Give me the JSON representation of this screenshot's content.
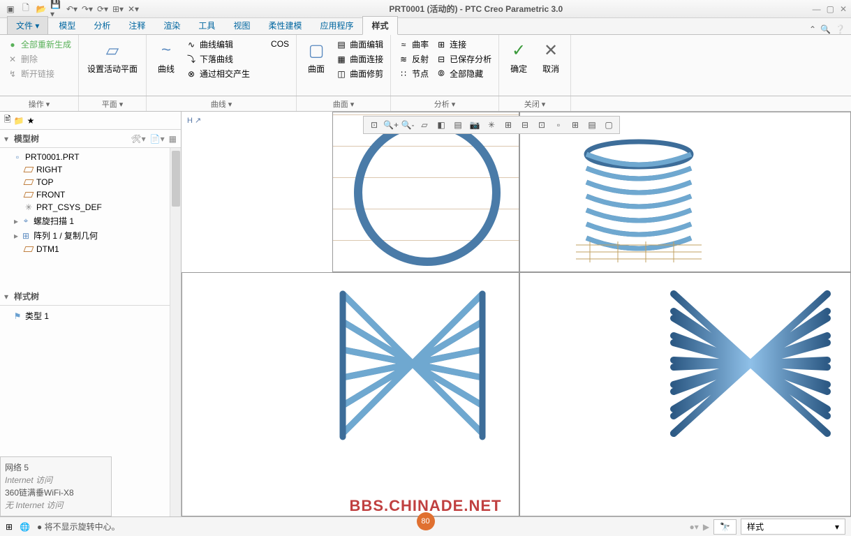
{
  "title": "PRT0001 (活动的) - PTC Creo Parametric 3.0",
  "tabs": [
    "文件 ▾",
    "模型",
    "分析",
    "注释",
    "渲染",
    "工具",
    "视图",
    "柔性建模",
    "应用程序",
    "样式"
  ],
  "active_tab": 9,
  "ribbon": {
    "groups": [
      {
        "label": "操作",
        "items": [
          {
            "t": "small",
            "label": "全部重新生成",
            "ico": "●",
            "cls": "bullet"
          },
          {
            "t": "small",
            "label": "删除",
            "ico": "✕",
            "cls": "dim"
          },
          {
            "t": "small",
            "label": "断开链接",
            "ico": "↯",
            "cls": "dim"
          }
        ]
      },
      {
        "label": "平面",
        "items": [
          {
            "t": "big",
            "label": "设置活动平面",
            "ico": "▱"
          }
        ]
      },
      {
        "label": "曲线",
        "items": [
          {
            "t": "big",
            "label": "曲线",
            "ico": "~"
          },
          {
            "t": "col",
            "sub": [
              {
                "label": "曲线编辑",
                "ico": "∿"
              },
              {
                "label": "下落曲线",
                "ico": "⤵"
              },
              {
                "label": "通过相交产生",
                "ico": "⊗"
              }
            ]
          },
          {
            "t": "small",
            "label": "COS",
            "ico": ""
          }
        ]
      },
      {
        "label": "曲面",
        "items": [
          {
            "t": "big",
            "label": "曲面",
            "ico": "▢"
          },
          {
            "t": "col",
            "sub": [
              {
                "label": "曲面编辑",
                "ico": "▤"
              },
              {
                "label": "曲面连接",
                "ico": "▦"
              },
              {
                "label": "曲面修剪",
                "ico": "◫"
              }
            ]
          }
        ]
      },
      {
        "label": "分析",
        "items": [
          {
            "t": "col",
            "sub": [
              {
                "label": "曲率",
                "ico": "≈"
              },
              {
                "label": "反射",
                "ico": "≋"
              },
              {
                "label": "节点",
                "ico": "∷"
              }
            ]
          },
          {
            "t": "col",
            "sub": [
              {
                "label": "连接",
                "ico": "⊞"
              },
              {
                "label": "已保存分析",
                "ico": "⊟"
              },
              {
                "label": "全部隐藏",
                "ico": "⦾"
              }
            ]
          }
        ]
      },
      {
        "label": "关闭",
        "items": [
          {
            "t": "big",
            "label": "确定",
            "ico": "✓",
            "color": "#3a9a3a"
          },
          {
            "t": "big",
            "label": "取消",
            "ico": "✕",
            "color": "#666"
          }
        ]
      }
    ]
  },
  "model_tree_title": "模型树",
  "model_tree": [
    {
      "label": "PRT0001.PRT",
      "ico": "box",
      "indent": 0
    },
    {
      "label": "RIGHT",
      "ico": "datum",
      "indent": 1
    },
    {
      "label": "TOP",
      "ico": "datum",
      "indent": 1
    },
    {
      "label": "FRONT",
      "ico": "datum",
      "indent": 1
    },
    {
      "label": "PRT_CSYS_DEF",
      "ico": "csys",
      "indent": 1
    },
    {
      "label": "螺旋扫描 1",
      "ico": "helix",
      "indent": 1,
      "exp": true
    },
    {
      "label": "阵列 1 / 复制几何",
      "ico": "pattern",
      "indent": 1,
      "exp": true
    },
    {
      "label": "DTM1",
      "ico": "datum",
      "indent": 1
    }
  ],
  "style_tree_title": "样式树",
  "style_tree": [
    {
      "label": "类型 1",
      "ico": "flag"
    }
  ],
  "network": {
    "l1": "网络  5",
    "l2": "Internet 访问",
    "l3": "360链满垂WiFi-X8",
    "l4": "无 Internet 访问"
  },
  "status": {
    "msg": "● 将不显示旋转中心。",
    "combo": "样式"
  },
  "watermark": "BBS.CHINADE.NET",
  "wm_badge": "80"
}
